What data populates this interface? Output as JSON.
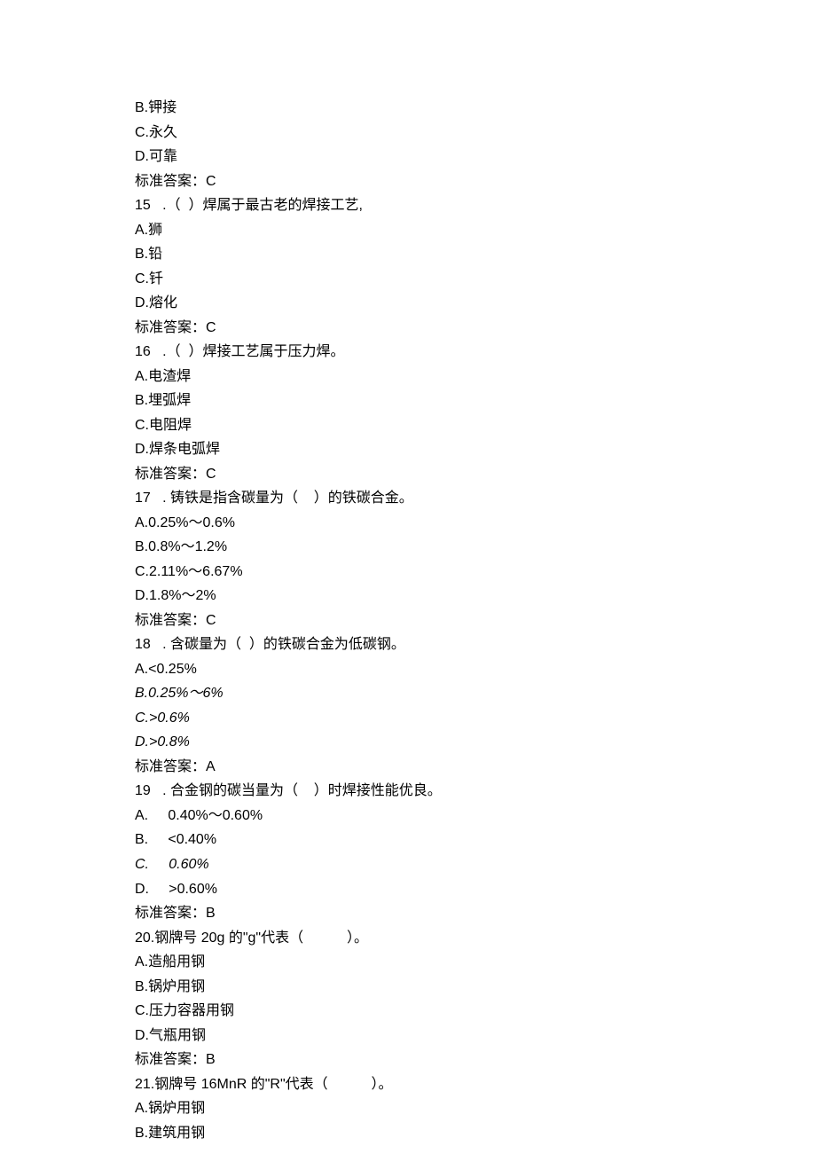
{
  "lines": [
    {
      "text": "B.钾接"
    },
    {
      "text": "C.永久"
    },
    {
      "text": "D.可靠"
    },
    {
      "text": "标准答案：C"
    },
    {
      "text": "15   .（  ）焊属于最古老的焊接工艺,"
    },
    {
      "text": "A.狮"
    },
    {
      "text": "B.铅"
    },
    {
      "text": "C.钎"
    },
    {
      "text": "D.熔化"
    },
    {
      "text": "标准答案：C"
    },
    {
      "text": "16   .（  ）焊接工艺属于压力焊。"
    },
    {
      "text": "A.电渣焊"
    },
    {
      "text": "B.埋弧焊"
    },
    {
      "text": "C.电阻焊"
    },
    {
      "text": "D.焊条电弧焊"
    },
    {
      "text": "标准答案：C"
    },
    {
      "text": "17   . 铸铁是指含碳量为（    ）的铁碳合金。"
    },
    {
      "text": "A.0.25%～0.6%"
    },
    {
      "text": "B.0.8%～1.2%"
    },
    {
      "text": "C.2.11%～6.67%"
    },
    {
      "text": "D.1.8%～2%"
    },
    {
      "text": "标准答案：C"
    },
    {
      "text": "18   . 含碳量为（  ）的铁碳合金为低碳钢。"
    },
    {
      "text": "A.<0.25%"
    },
    {
      "text": "B.0.25%～6%",
      "italic": true
    },
    {
      "text": "C.>0.6%",
      "italic": true
    },
    {
      "text": "D.>0.8%",
      "italic": true
    },
    {
      "text": "标准答案：A"
    },
    {
      "text": "19   . 合金钢的碳当量为（    ）时焊接性能优良。"
    },
    {
      "text": "A.     0.40%～0.60%"
    },
    {
      "text": "B.     <0.40%"
    },
    {
      "text": "C.     0.60%",
      "italic": true
    },
    {
      "text": "D.     >0.60%"
    },
    {
      "text": "标准答案：B"
    },
    {
      "text": "20.钢牌号 20g 的\"g\"代表（           ）。"
    },
    {
      "text": "A.造船用钢"
    },
    {
      "text": "B.锅炉用钢"
    },
    {
      "text": "C.压力容器用钢"
    },
    {
      "text": "D.气瓶用钢"
    },
    {
      "text": "标准答案：B"
    },
    {
      "text": "21.钢牌号 16MnR 的\"R\"代表（           ）。"
    },
    {
      "text": "A.锅炉用钢"
    },
    {
      "text": "B.建筑用钢"
    }
  ]
}
